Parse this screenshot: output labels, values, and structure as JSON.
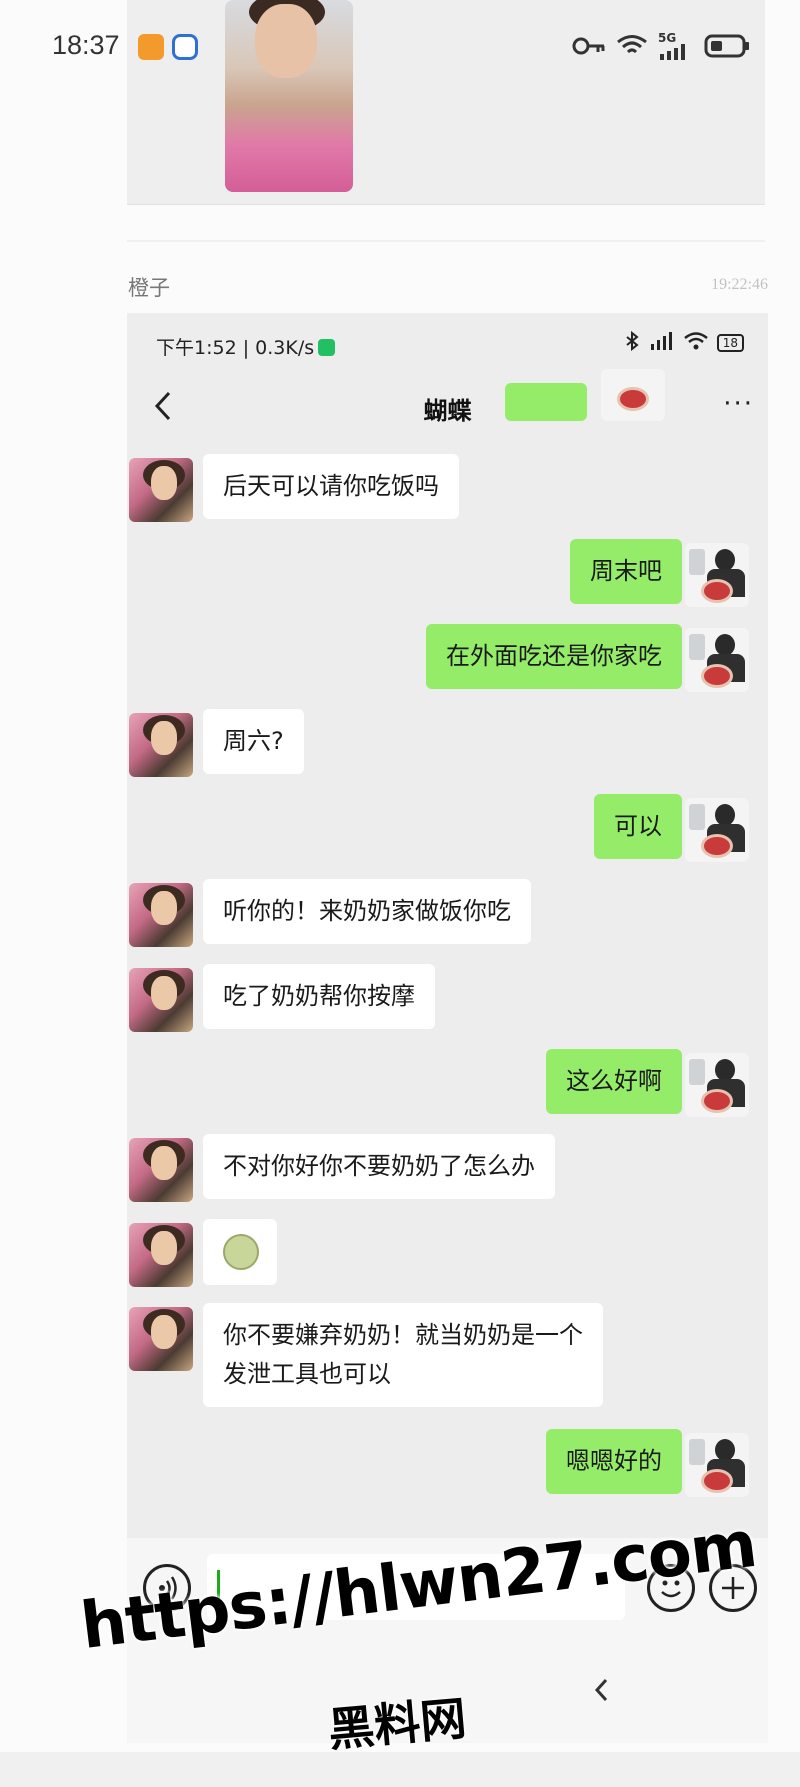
{
  "outer_status": {
    "time": "18:37",
    "network": "5G"
  },
  "outer_chat": {
    "sender_name": "橙子",
    "timestamp": "19:22:46"
  },
  "inner_status": {
    "time_speed": "下午1:52 | 0.3K/s",
    "battery": "18"
  },
  "inner_nav": {
    "title": "蝴蝶",
    "more": "···"
  },
  "messages": [
    {
      "side": "left",
      "text": "后天可以请你吃饭吗"
    },
    {
      "side": "right",
      "text": "周末吧"
    },
    {
      "side": "right",
      "text": "在外面吃还是你家吃"
    },
    {
      "side": "left",
      "text": "周六?"
    },
    {
      "side": "right",
      "text": "可以"
    },
    {
      "side": "left",
      "text": "听你的！来奶奶家做饭你吃"
    },
    {
      "side": "left",
      "text": "吃了奶奶帮你按摩"
    },
    {
      "side": "right",
      "text": "这么好啊"
    },
    {
      "side": "left",
      "text": "不对你好你不要奶奶了怎么办"
    },
    {
      "side": "left",
      "type": "emoji"
    },
    {
      "side": "left",
      "text_line1": "你不要嫌弃奶奶！就当奶奶是一个",
      "text_line2": "发泄工具也可以"
    },
    {
      "side": "right",
      "text": "嗯嗯好的"
    }
  ],
  "watermark": {
    "url": "https://hlwn27.com",
    "name": "黑料网"
  }
}
